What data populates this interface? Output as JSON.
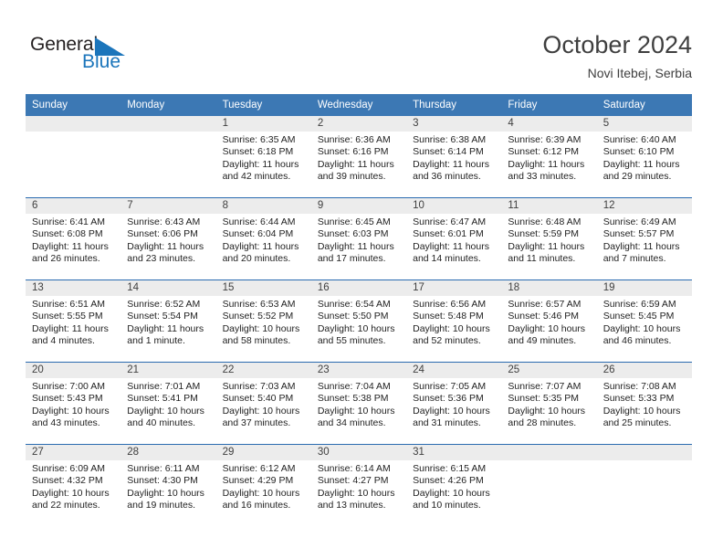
{
  "brand": {
    "name_part1": "General",
    "name_part2": "Blue",
    "flag_icon": "triangle-flag-icon",
    "color_dark": "#231f20",
    "color_blue": "#1b75bb"
  },
  "header": {
    "title": "October 2024",
    "subtitle": "Novi Itebej, Serbia"
  },
  "theme": {
    "header_row_bg": "#3c78b4",
    "row_divider": "#2a6bb0",
    "daynum_strip_bg": "#ececec",
    "text": "#1f1f1f"
  },
  "weekday_headers": [
    "Sunday",
    "Monday",
    "Tuesday",
    "Wednesday",
    "Thursday",
    "Friday",
    "Saturday"
  ],
  "weeks": [
    [
      {
        "day": "",
        "sunrise": "",
        "sunset": "",
        "daylight1": "",
        "daylight2": ""
      },
      {
        "day": "",
        "sunrise": "",
        "sunset": "",
        "daylight1": "",
        "daylight2": ""
      },
      {
        "day": "1",
        "sunrise": "Sunrise: 6:35 AM",
        "sunset": "Sunset: 6:18 PM",
        "daylight1": "Daylight: 11 hours",
        "daylight2": "and 42 minutes."
      },
      {
        "day": "2",
        "sunrise": "Sunrise: 6:36 AM",
        "sunset": "Sunset: 6:16 PM",
        "daylight1": "Daylight: 11 hours",
        "daylight2": "and 39 minutes."
      },
      {
        "day": "3",
        "sunrise": "Sunrise: 6:38 AM",
        "sunset": "Sunset: 6:14 PM",
        "daylight1": "Daylight: 11 hours",
        "daylight2": "and 36 minutes."
      },
      {
        "day": "4",
        "sunrise": "Sunrise: 6:39 AM",
        "sunset": "Sunset: 6:12 PM",
        "daylight1": "Daylight: 11 hours",
        "daylight2": "and 33 minutes."
      },
      {
        "day": "5",
        "sunrise": "Sunrise: 6:40 AM",
        "sunset": "Sunset: 6:10 PM",
        "daylight1": "Daylight: 11 hours",
        "daylight2": "and 29 minutes."
      }
    ],
    [
      {
        "day": "6",
        "sunrise": "Sunrise: 6:41 AM",
        "sunset": "Sunset: 6:08 PM",
        "daylight1": "Daylight: 11 hours",
        "daylight2": "and 26 minutes."
      },
      {
        "day": "7",
        "sunrise": "Sunrise: 6:43 AM",
        "sunset": "Sunset: 6:06 PM",
        "daylight1": "Daylight: 11 hours",
        "daylight2": "and 23 minutes."
      },
      {
        "day": "8",
        "sunrise": "Sunrise: 6:44 AM",
        "sunset": "Sunset: 6:04 PM",
        "daylight1": "Daylight: 11 hours",
        "daylight2": "and 20 minutes."
      },
      {
        "day": "9",
        "sunrise": "Sunrise: 6:45 AM",
        "sunset": "Sunset: 6:03 PM",
        "daylight1": "Daylight: 11 hours",
        "daylight2": "and 17 minutes."
      },
      {
        "day": "10",
        "sunrise": "Sunrise: 6:47 AM",
        "sunset": "Sunset: 6:01 PM",
        "daylight1": "Daylight: 11 hours",
        "daylight2": "and 14 minutes."
      },
      {
        "day": "11",
        "sunrise": "Sunrise: 6:48 AM",
        "sunset": "Sunset: 5:59 PM",
        "daylight1": "Daylight: 11 hours",
        "daylight2": "and 11 minutes."
      },
      {
        "day": "12",
        "sunrise": "Sunrise: 6:49 AM",
        "sunset": "Sunset: 5:57 PM",
        "daylight1": "Daylight: 11 hours",
        "daylight2": "and 7 minutes."
      }
    ],
    [
      {
        "day": "13",
        "sunrise": "Sunrise: 6:51 AM",
        "sunset": "Sunset: 5:55 PM",
        "daylight1": "Daylight: 11 hours",
        "daylight2": "and 4 minutes."
      },
      {
        "day": "14",
        "sunrise": "Sunrise: 6:52 AM",
        "sunset": "Sunset: 5:54 PM",
        "daylight1": "Daylight: 11 hours",
        "daylight2": "and 1 minute."
      },
      {
        "day": "15",
        "sunrise": "Sunrise: 6:53 AM",
        "sunset": "Sunset: 5:52 PM",
        "daylight1": "Daylight: 10 hours",
        "daylight2": "and 58 minutes."
      },
      {
        "day": "16",
        "sunrise": "Sunrise: 6:54 AM",
        "sunset": "Sunset: 5:50 PM",
        "daylight1": "Daylight: 10 hours",
        "daylight2": "and 55 minutes."
      },
      {
        "day": "17",
        "sunrise": "Sunrise: 6:56 AM",
        "sunset": "Sunset: 5:48 PM",
        "daylight1": "Daylight: 10 hours",
        "daylight2": "and 52 minutes."
      },
      {
        "day": "18",
        "sunrise": "Sunrise: 6:57 AM",
        "sunset": "Sunset: 5:46 PM",
        "daylight1": "Daylight: 10 hours",
        "daylight2": "and 49 minutes."
      },
      {
        "day": "19",
        "sunrise": "Sunrise: 6:59 AM",
        "sunset": "Sunset: 5:45 PM",
        "daylight1": "Daylight: 10 hours",
        "daylight2": "and 46 minutes."
      }
    ],
    [
      {
        "day": "20",
        "sunrise": "Sunrise: 7:00 AM",
        "sunset": "Sunset: 5:43 PM",
        "daylight1": "Daylight: 10 hours",
        "daylight2": "and 43 minutes."
      },
      {
        "day": "21",
        "sunrise": "Sunrise: 7:01 AM",
        "sunset": "Sunset: 5:41 PM",
        "daylight1": "Daylight: 10 hours",
        "daylight2": "and 40 minutes."
      },
      {
        "day": "22",
        "sunrise": "Sunrise: 7:03 AM",
        "sunset": "Sunset: 5:40 PM",
        "daylight1": "Daylight: 10 hours",
        "daylight2": "and 37 minutes."
      },
      {
        "day": "23",
        "sunrise": "Sunrise: 7:04 AM",
        "sunset": "Sunset: 5:38 PM",
        "daylight1": "Daylight: 10 hours",
        "daylight2": "and 34 minutes."
      },
      {
        "day": "24",
        "sunrise": "Sunrise: 7:05 AM",
        "sunset": "Sunset: 5:36 PM",
        "daylight1": "Daylight: 10 hours",
        "daylight2": "and 31 minutes."
      },
      {
        "day": "25",
        "sunrise": "Sunrise: 7:07 AM",
        "sunset": "Sunset: 5:35 PM",
        "daylight1": "Daylight: 10 hours",
        "daylight2": "and 28 minutes."
      },
      {
        "day": "26",
        "sunrise": "Sunrise: 7:08 AM",
        "sunset": "Sunset: 5:33 PM",
        "daylight1": "Daylight: 10 hours",
        "daylight2": "and 25 minutes."
      }
    ],
    [
      {
        "day": "27",
        "sunrise": "Sunrise: 6:09 AM",
        "sunset": "Sunset: 4:32 PM",
        "daylight1": "Daylight: 10 hours",
        "daylight2": "and 22 minutes."
      },
      {
        "day": "28",
        "sunrise": "Sunrise: 6:11 AM",
        "sunset": "Sunset: 4:30 PM",
        "daylight1": "Daylight: 10 hours",
        "daylight2": "and 19 minutes."
      },
      {
        "day": "29",
        "sunrise": "Sunrise: 6:12 AM",
        "sunset": "Sunset: 4:29 PM",
        "daylight1": "Daylight: 10 hours",
        "daylight2": "and 16 minutes."
      },
      {
        "day": "30",
        "sunrise": "Sunrise: 6:14 AM",
        "sunset": "Sunset: 4:27 PM",
        "daylight1": "Daylight: 10 hours",
        "daylight2": "and 13 minutes."
      },
      {
        "day": "31",
        "sunrise": "Sunrise: 6:15 AM",
        "sunset": "Sunset: 4:26 PM",
        "daylight1": "Daylight: 10 hours",
        "daylight2": "and 10 minutes."
      },
      {
        "day": "",
        "sunrise": "",
        "sunset": "",
        "daylight1": "",
        "daylight2": ""
      },
      {
        "day": "",
        "sunrise": "",
        "sunset": "",
        "daylight1": "",
        "daylight2": ""
      }
    ]
  ]
}
